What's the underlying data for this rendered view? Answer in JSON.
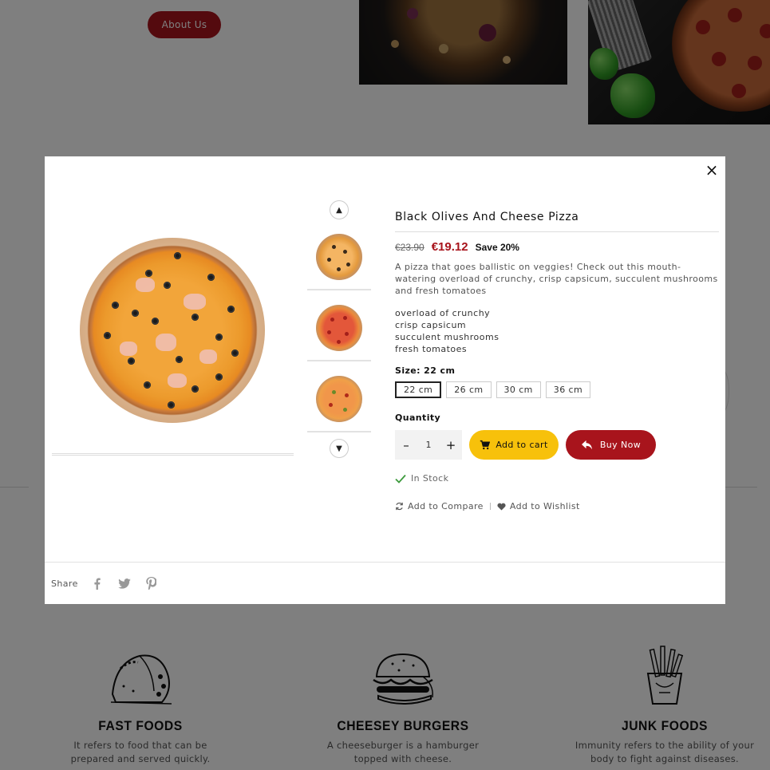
{
  "background": {
    "about_button": "About Us",
    "features": [
      {
        "title": "FAST FOODS",
        "desc_line1": "It refers to food that can be",
        "desc_line2": "prepared and served quickly."
      },
      {
        "title": "CHEESEY BURGERS",
        "desc_line1": "A cheeseburger is a hamburger",
        "desc_line2": "topped with cheese."
      },
      {
        "title": "JUNK FOODS",
        "desc_line1": "Immunity refers to the ability of your",
        "desc_line2": "body to fight against diseases."
      }
    ]
  },
  "modal": {
    "close_icon": "×",
    "title": "Black Olives And Cheese Pizza",
    "old_price": "€23.90",
    "new_price": "€19.12",
    "save_label": "Save 20%",
    "description": "A pizza that goes ballistic on veggies! Check out this mouth-watering overload of crunchy, crisp capsicum, succulent mushrooms and fresh tomatoes",
    "feature_items": [
      "overload of crunchy",
      "crisp capsicum",
      "succulent mushrooms",
      "fresh tomatoes"
    ],
    "size_label": "Size: 22 cm",
    "sizes": [
      "22 cm",
      "26 cm",
      "30 cm",
      "36 cm"
    ],
    "selected_size": "22 cm",
    "quantity_label": "Quantity",
    "quantity_value": "1",
    "add_to_cart": "Add to cart",
    "buy_now": "Buy Now",
    "stock_status": "In Stock",
    "add_to_compare": "Add to Compare",
    "add_to_wishlist": "Add to Wishlist",
    "share_label": "Share",
    "share_icons": [
      "facebook-icon",
      "twitter-icon",
      "pinterest-icon"
    ],
    "thumbnail_count": 3
  },
  "colors": {
    "brand_red": "#a8141c",
    "cart_yellow": "#f7c10b",
    "stock_green": "#3c9a3c"
  }
}
